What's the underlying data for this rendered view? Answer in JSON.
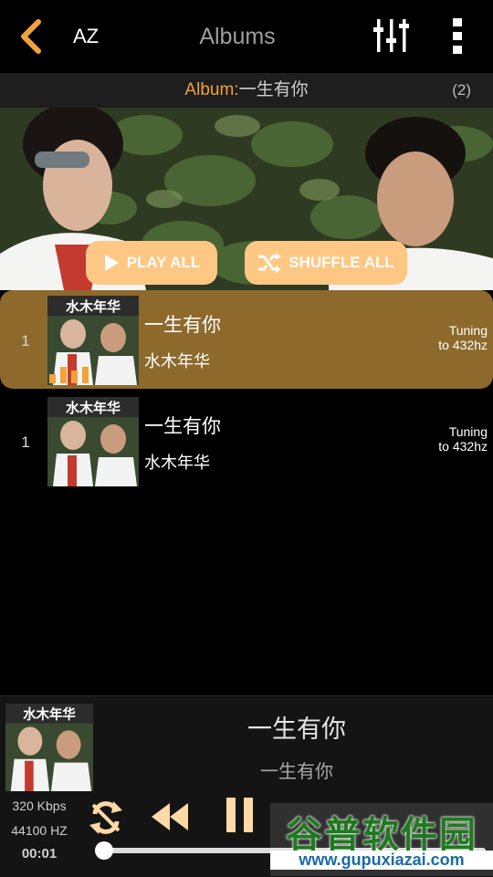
{
  "header": {
    "title": "Albums",
    "az_label": "AZ"
  },
  "album_bar": {
    "prefix": "Album:",
    "album_name": "一生有你",
    "count": "(2)"
  },
  "actions": {
    "play_all": "PLAY ALL",
    "shuffle_all": "SHUFFLE ALL"
  },
  "tracks": [
    {
      "number": "1",
      "title": "一生有你",
      "artist": "水木年华",
      "tuning_line1": "Tuning",
      "tuning_line2": "to 432hz",
      "playing": true
    },
    {
      "number": "1",
      "title": "一生有你",
      "artist": "水木年华",
      "tuning_line1": "Tuning",
      "tuning_line2": "to 432hz",
      "playing": false
    }
  ],
  "now_playing": {
    "title": "一生有你",
    "subtitle": "一生有你",
    "bitrate": "320 Kbps",
    "sample_rate": "44100 HZ",
    "elapsed": "00:01",
    "progress_fraction": 0.01
  },
  "cover_text": "水木年华",
  "watermark": {
    "name": "谷普软件园",
    "url": "www.gupuxiazai.com"
  },
  "colors": {
    "accent": "#f2a23b",
    "active_row": "#8d6a2c",
    "pill": "#ffc784"
  }
}
